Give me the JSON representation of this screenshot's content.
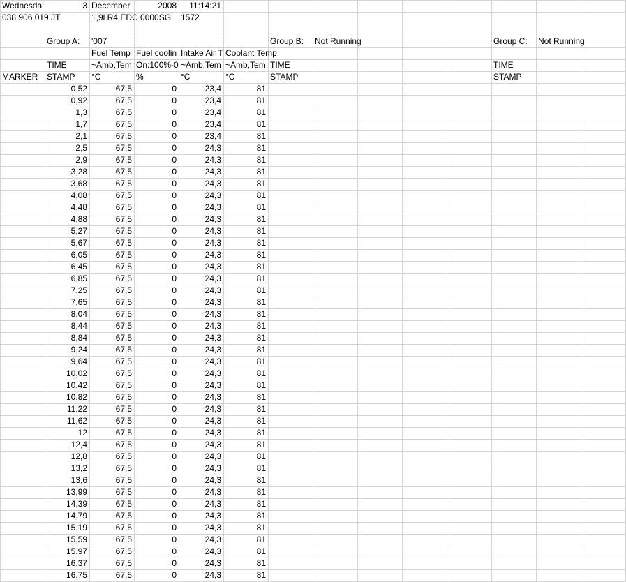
{
  "header": {
    "r1": [
      "Wednesda",
      "3",
      "December",
      "2008",
      "11:14:21"
    ],
    "r2": [
      "038 906 019 JT",
      "1,9l R4 EDC 0000SG",
      "1572"
    ]
  },
  "groups": {
    "a_label": "Group A:",
    "a_value": "'007",
    "b_label": "Group B:",
    "b_value": "Not Running",
    "c_label": "Group C:",
    "c_value": "Not Running"
  },
  "columns": {
    "names": [
      "Fuel Temp",
      "Fuel coolin",
      "Intake Air T",
      "Coolant Temp"
    ],
    "ranges": [
      "~Amb,Tem",
      "On:100%-0",
      "~Amb,Tem",
      "~Amb,Tem"
    ],
    "units": [
      "°C",
      "%",
      "°C",
      "°C"
    ],
    "time": "TIME",
    "stamp": "STAMP",
    "marker": "MARKER"
  },
  "rows": [
    [
      "0,52",
      "67,5",
      "0",
      "23,4",
      "81"
    ],
    [
      "0,92",
      "67,5",
      "0",
      "23,4",
      "81"
    ],
    [
      "1,3",
      "67,5",
      "0",
      "23,4",
      "81"
    ],
    [
      "1,7",
      "67,5",
      "0",
      "23,4",
      "81"
    ],
    [
      "2,1",
      "67,5",
      "0",
      "23,4",
      "81"
    ],
    [
      "2,5",
      "67,5",
      "0",
      "24,3",
      "81"
    ],
    [
      "2,9",
      "67,5",
      "0",
      "24,3",
      "81"
    ],
    [
      "3,28",
      "67,5",
      "0",
      "24,3",
      "81"
    ],
    [
      "3,68",
      "67,5",
      "0",
      "24,3",
      "81"
    ],
    [
      "4,08",
      "67,5",
      "0",
      "24,3",
      "81"
    ],
    [
      "4,48",
      "67,5",
      "0",
      "24,3",
      "81"
    ],
    [
      "4,88",
      "67,5",
      "0",
      "24,3",
      "81"
    ],
    [
      "5,27",
      "67,5",
      "0",
      "24,3",
      "81"
    ],
    [
      "5,67",
      "67,5",
      "0",
      "24,3",
      "81"
    ],
    [
      "6,05",
      "67,5",
      "0",
      "24,3",
      "81"
    ],
    [
      "6,45",
      "67,5",
      "0",
      "24,3",
      "81"
    ],
    [
      "6,85",
      "67,5",
      "0",
      "24,3",
      "81"
    ],
    [
      "7,25",
      "67,5",
      "0",
      "24,3",
      "81"
    ],
    [
      "7,65",
      "67,5",
      "0",
      "24,3",
      "81"
    ],
    [
      "8,04",
      "67,5",
      "0",
      "24,3",
      "81"
    ],
    [
      "8,44",
      "67,5",
      "0",
      "24,3",
      "81"
    ],
    [
      "8,84",
      "67,5",
      "0",
      "24,3",
      "81"
    ],
    [
      "9,24",
      "67,5",
      "0",
      "24,3",
      "81"
    ],
    [
      "9,64",
      "67,5",
      "0",
      "24,3",
      "81"
    ],
    [
      "10,02",
      "67,5",
      "0",
      "24,3",
      "81"
    ],
    [
      "10,42",
      "67,5",
      "0",
      "24,3",
      "81"
    ],
    [
      "10,82",
      "67,5",
      "0",
      "24,3",
      "81"
    ],
    [
      "11,22",
      "67,5",
      "0",
      "24,3",
      "81"
    ],
    [
      "11,62",
      "67,5",
      "0",
      "24,3",
      "81"
    ],
    [
      "12",
      "67,5",
      "0",
      "24,3",
      "81"
    ],
    [
      "12,4",
      "67,5",
      "0",
      "24,3",
      "81"
    ],
    [
      "12,8",
      "67,5",
      "0",
      "24,3",
      "81"
    ],
    [
      "13,2",
      "67,5",
      "0",
      "24,3",
      "81"
    ],
    [
      "13,6",
      "67,5",
      "0",
      "24,3",
      "81"
    ],
    [
      "13,99",
      "67,5",
      "0",
      "24,3",
      "81"
    ],
    [
      "14,39",
      "67,5",
      "0",
      "24,3",
      "81"
    ],
    [
      "14,79",
      "67,5",
      "0",
      "24,3",
      "81"
    ],
    [
      "15,19",
      "67,5",
      "0",
      "24,3",
      "81"
    ],
    [
      "15,59",
      "67,5",
      "0",
      "24,3",
      "81"
    ],
    [
      "15,97",
      "67,5",
      "0",
      "24,3",
      "81"
    ],
    [
      "16,37",
      "67,5",
      "0",
      "24,3",
      "81"
    ],
    [
      "16,75",
      "67,5",
      "0",
      "24,3",
      "81"
    ]
  ]
}
